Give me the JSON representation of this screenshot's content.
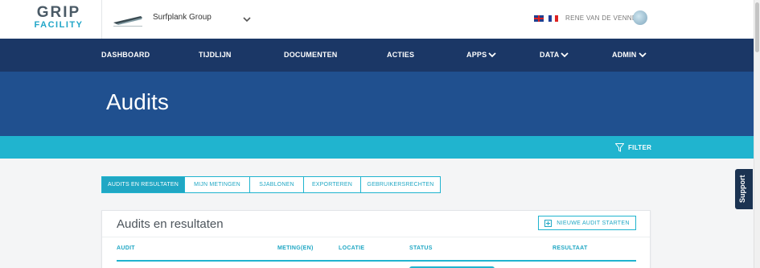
{
  "brand": {
    "line1": "GRIP",
    "line2": "FACILITY"
  },
  "company": {
    "name": "Surfplank Group",
    "logo_icon": "company-logo"
  },
  "user": {
    "name": "RENE VAN DE VENNE",
    "languages": [
      "EN",
      "FR"
    ]
  },
  "nav": {
    "items": [
      {
        "label": "DASHBOARD",
        "dropdown": false
      },
      {
        "label": "TIJDLIJN",
        "dropdown": false
      },
      {
        "label": "DOCUMENTEN",
        "dropdown": false
      },
      {
        "label": "ACTIES",
        "dropdown": false
      },
      {
        "label": "APPS",
        "dropdown": true
      },
      {
        "label": "DATA",
        "dropdown": true
      },
      {
        "label": "ADMIN",
        "dropdown": true
      }
    ]
  },
  "page": {
    "title": "Audits"
  },
  "filter": {
    "label": "FILTER"
  },
  "tabs": [
    {
      "label": "AUDITS EN RESULTATEN",
      "active": true
    },
    {
      "label": "MIJN METINGEN",
      "active": false
    },
    {
      "label": "SJABLONEN",
      "active": false
    },
    {
      "label": "EXPORTEREN",
      "active": false
    },
    {
      "label": "GEBRUIKERSRECHTEN",
      "active": false
    }
  ],
  "card": {
    "title": "Audits en resultaten",
    "new_button": "NIEUWE AUDIT STARTEN",
    "columns": [
      "AUDIT",
      "METING(EN)",
      "LOCATIE",
      "STATUS",
      "RESULTAAT"
    ]
  },
  "support": {
    "label": "Support"
  },
  "colors": {
    "navy": "#1b3766",
    "blue": "#20508f",
    "cyan": "#20b4cf"
  }
}
